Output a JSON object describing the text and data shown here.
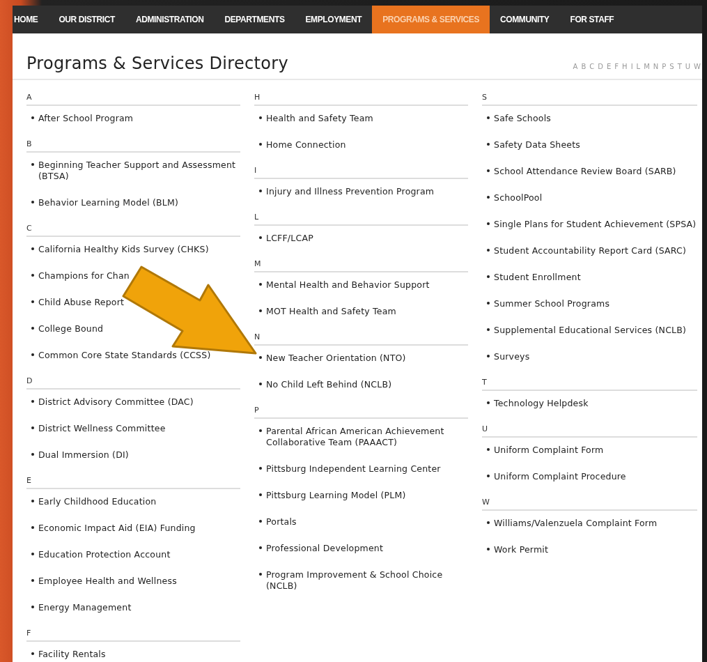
{
  "nav": [
    {
      "label": "HOME",
      "selected": false
    },
    {
      "label": "OUR DISTRICT",
      "selected": false
    },
    {
      "label": "ADMINISTRATION",
      "selected": false
    },
    {
      "label": "DEPARTMENTS",
      "selected": false
    },
    {
      "label": "EMPLOYMENT",
      "selected": false
    },
    {
      "label": "PROGRAMS & SERVICES",
      "selected": true
    },
    {
      "label": "COMMUNITY",
      "selected": false
    },
    {
      "label": "FOR STAFF",
      "selected": false
    }
  ],
  "title": "Programs & Services Directory",
  "alphabet": [
    "A",
    "B",
    "C",
    "D",
    "E",
    "F",
    "H",
    "I",
    "L",
    "M",
    "N",
    "P",
    "S",
    "T",
    "U",
    "W"
  ],
  "columns": [
    [
      {
        "letter": "A",
        "items": [
          "After School Program"
        ]
      },
      {
        "letter": "B",
        "items": [
          "Beginning Teacher Support and Assessment (BTSA)",
          "Behavior Learning Model (BLM)"
        ]
      },
      {
        "letter": "C",
        "items": [
          "California Healthy Kids Survey (CHKS)",
          "Champions for Chan",
          "Child Abuse Report",
          "College Bound",
          "Common Core State Standards (CCSS)"
        ]
      },
      {
        "letter": "D",
        "items": [
          "District Advisory Committee (DAC)",
          "District Wellness Committee",
          "Dual Immersion (DI)"
        ]
      },
      {
        "letter": "E",
        "items": [
          "Early Childhood Education",
          "Economic Impact Aid (EIA) Funding",
          "Education Protection Account",
          "Employee Health and Wellness",
          "Energy Management"
        ]
      },
      {
        "letter": "F",
        "items": [
          "Facility Rentals"
        ]
      }
    ],
    [
      {
        "letter": "H",
        "items": [
          "Health and Safety Team",
          "Home Connection"
        ]
      },
      {
        "letter": "I",
        "items": [
          "Injury and Illness Prevention Program"
        ]
      },
      {
        "letter": "L",
        "items": [
          "LCFF/LCAP"
        ]
      },
      {
        "letter": "M",
        "items": [
          "Mental Health and Behavior Support",
          "MOT Health and Safety Team"
        ]
      },
      {
        "letter": "N",
        "items": [
          "New Teacher Orientation (NTO)",
          "No Child Left Behind (NCLB)"
        ]
      },
      {
        "letter": "P",
        "items": [
          "Parental African American Achievement Collaborative Team (PAAACT)",
          "Pittsburg Independent Learning Center",
          "Pittsburg Learning Model (PLM)",
          "Portals",
          "Professional Development",
          "Program Improvement & School Choice (NCLB)"
        ]
      }
    ],
    [
      {
        "letter": "S",
        "items": [
          "Safe Schools",
          "Safety Data Sheets",
          "School Attendance Review Board (SARB)",
          "SchoolPool",
          "Single Plans for Student Achievement (SPSA)",
          "Student Accountability Report Card (SARC)",
          "Student Enrollment",
          "Summer School Programs",
          "Supplemental Educational Services (NCLB)",
          "Surveys"
        ]
      },
      {
        "letter": "T",
        "items": [
          "Technology Helpdesk"
        ]
      },
      {
        "letter": "U",
        "items": [
          "Uniform Complaint Form",
          "Uniform Complaint Procedure"
        ]
      },
      {
        "letter": "W",
        "items": [
          "Williams/Valenzuela Complaint Form",
          "Work Permit"
        ]
      }
    ]
  ]
}
